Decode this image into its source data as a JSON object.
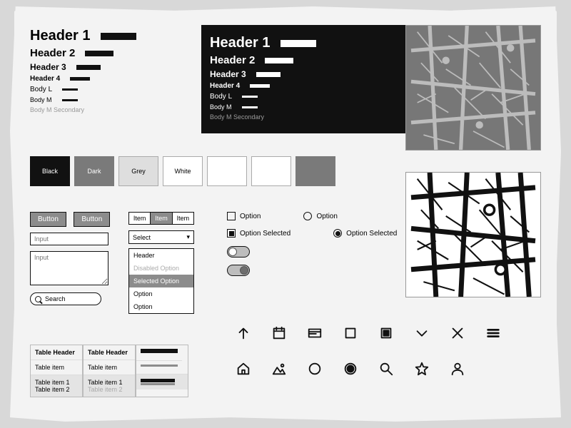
{
  "typography": {
    "h1": "Header 1",
    "h2": "Header 2",
    "h3": "Header 3",
    "h4": "Header 4",
    "bodyL": "Body L",
    "bodyM": "Body M",
    "bodyMSecondary": "Body M Secondary"
  },
  "swatches": {
    "black": "Black",
    "dark": "Dark",
    "grey": "Grey",
    "white": "White"
  },
  "colors": {
    "black": "#111111",
    "dark": "#7a7a7a",
    "grey": "#dedede",
    "white": "#ffffff"
  },
  "forms": {
    "button": "Button",
    "input_placeholder": "Input",
    "search_placeholder": "Search",
    "tabs": [
      "Item",
      "Item",
      "Item"
    ],
    "select_label": "Select",
    "list": {
      "header": "Header",
      "disabled": "Disabled Option",
      "selected": "Selected Option",
      "option": "Option"
    }
  },
  "options": {
    "option": "Option",
    "option_selected": "Option Selected"
  },
  "table": {
    "header": "Table Header",
    "item": "Table item",
    "item1": "Table item 1",
    "item2": "Table item 2"
  },
  "icons": [
    "arrow-up",
    "calendar",
    "card",
    "square",
    "square-filled",
    "chevron-down",
    "close",
    "menu",
    "home",
    "image",
    "circle",
    "circle-filled",
    "search",
    "star",
    "user"
  ]
}
